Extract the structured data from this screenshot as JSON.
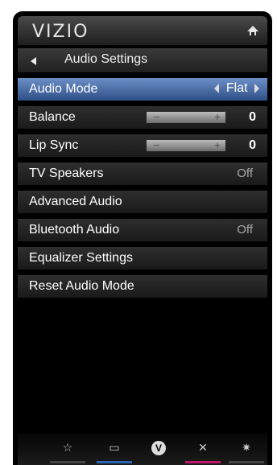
{
  "app": {
    "brand": "VIZIO",
    "title": "Audio Settings"
  },
  "menu": {
    "items": [
      {
        "label": "Audio Mode",
        "value": "Flat",
        "selected": true
      },
      {
        "label": "Balance",
        "value": "0",
        "slider": true
      },
      {
        "label": "Lip Sync",
        "value": "0",
        "slider": true
      },
      {
        "label": "TV Speakers",
        "value": "Off"
      },
      {
        "label": "Advanced Audio"
      },
      {
        "label": "Bluetooth Audio",
        "value": "Off"
      },
      {
        "label": "Equalizer Settings"
      },
      {
        "label": "Reset Audio Mode"
      }
    ]
  },
  "icons": {
    "home": "home-icon",
    "back": "back-icon",
    "bottom": [
      "star-icon",
      "display-icon",
      "vizio-logo-icon",
      "close-icon",
      "gear-icon"
    ]
  },
  "colors": {
    "selected_row": "#3f64a8",
    "display_underline": "#2a66b3",
    "close_underline": "#c2186b"
  }
}
